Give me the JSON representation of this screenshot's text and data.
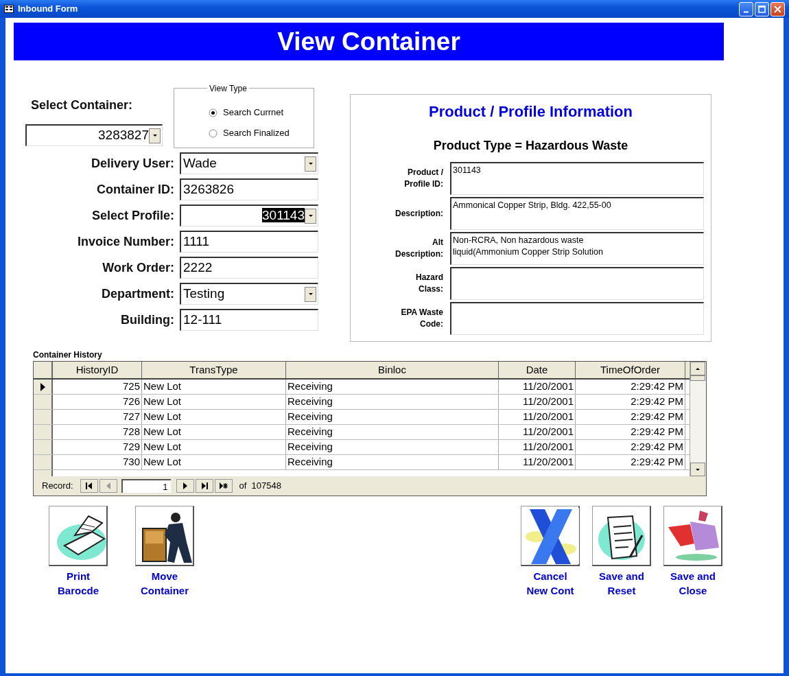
{
  "window": {
    "title": "Inbound Form"
  },
  "banner": "View Container",
  "select_container": {
    "label": "Select Container:",
    "value": "3283827"
  },
  "view_type": {
    "legend": "View Type",
    "options": [
      {
        "label": "Search Currnet",
        "selected": true
      },
      {
        "label": "Search Finalized",
        "selected": false
      }
    ]
  },
  "fields": [
    {
      "label": "Delivery User:",
      "value": "Wade",
      "kind": "combo",
      "highlighted": false
    },
    {
      "label": "Container ID:",
      "value": "3263826",
      "kind": "text",
      "highlighted": false
    },
    {
      "label": "Select Profile:",
      "value": "301143",
      "kind": "combo",
      "highlighted": true
    },
    {
      "label": "Invoice Number:",
      "value": "1111",
      "kind": "text",
      "highlighted": false
    },
    {
      "label": "Work Order:",
      "value": "2222",
      "kind": "text",
      "highlighted": false
    },
    {
      "label": "Department:",
      "value": "Testing",
      "kind": "combo",
      "highlighted": false
    },
    {
      "label": "Building:",
      "value": "12-111",
      "kind": "text",
      "highlighted": false
    }
  ],
  "profile_panel": {
    "title": "Product / Profile Information",
    "subtitle": "Product Type = Hazardous Waste",
    "fields": [
      {
        "label": "Product /\nProfile ID:",
        "value": "301143"
      },
      {
        "label": "Description:",
        "value": "Ammonical Copper Strip, Bldg. 422,55-00"
      },
      {
        "label": "Alt\nDescription:",
        "value": "Non-RCRA, Non hazardous waste\nliquid(Ammonium Copper Strip Solution"
      },
      {
        "label": "Hazard\nClass:"
      },
      {
        "label": "EPA Waste\nCode:"
      }
    ]
  },
  "history": {
    "caption": "Container History",
    "columns": [
      "HistoryID",
      "TransType",
      "Binloc",
      "Date",
      "TimeOfOrder"
    ],
    "rows": [
      {
        "cells": [
          "725",
          "New Lot",
          "Receiving",
          "11/20/2001",
          "2:29:42 PM"
        ],
        "selected": true
      },
      {
        "cells": [
          "726",
          "New Lot",
          "Receiving",
          "11/20/2001",
          "2:29:42 PM"
        ],
        "selected": false
      },
      {
        "cells": [
          "727",
          "New Lot",
          "Receiving",
          "11/20/2001",
          "2:29:42 PM"
        ],
        "selected": false
      },
      {
        "cells": [
          "728",
          "New Lot",
          "Receiving",
          "11/20/2001",
          "2:29:42 PM"
        ],
        "selected": false
      },
      {
        "cells": [
          "729",
          "New Lot",
          "Receiving",
          "11/20/2001",
          "2:29:42 PM"
        ],
        "selected": false
      },
      {
        "cells": [
          "730",
          "New Lot",
          "Receiving",
          "11/20/2001",
          "2:29:42 PM"
        ],
        "selected": false
      }
    ],
    "navigator": {
      "label": "Record:",
      "current": "1",
      "of": "of",
      "total": "107548"
    }
  },
  "actions_left": [
    {
      "kind": "print",
      "label": "Print\nBarocde"
    },
    {
      "kind": "move",
      "label": "Move\nContainer"
    }
  ],
  "actions_right": [
    {
      "kind": "cancel",
      "label": "Cancel\nNew Cont"
    },
    {
      "kind": "reset",
      "label": "Save and\nReset"
    },
    {
      "kind": "close",
      "label": "Save and\nClose"
    }
  ]
}
